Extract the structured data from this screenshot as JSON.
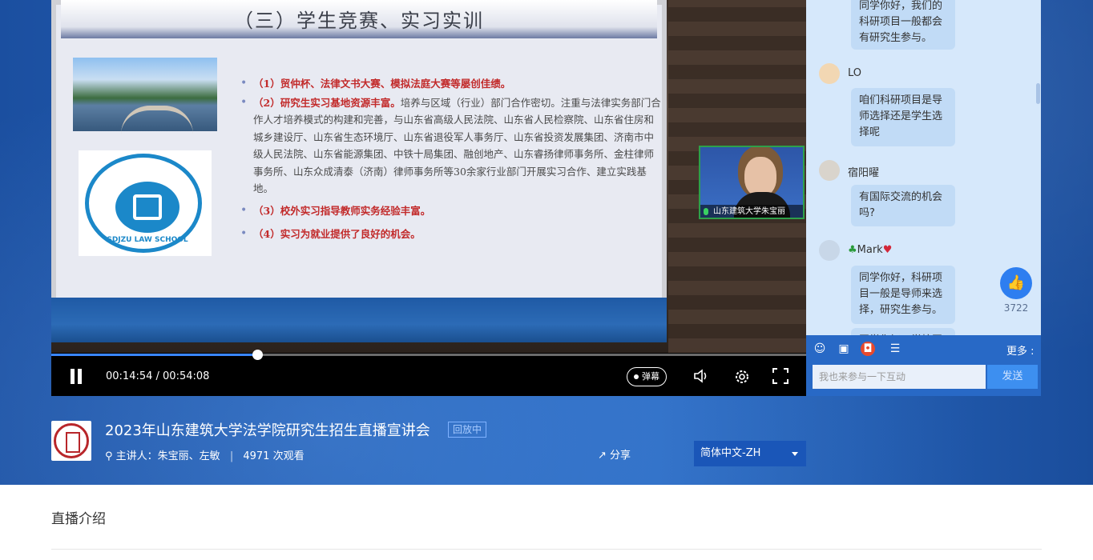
{
  "slide": {
    "title": "（三）学生竞赛、实习实训",
    "logo_text": "SDJZU LAW SCHOOL",
    "bullets": [
      {
        "red": "（1）贸仲杯、法律文书大赛、模拟法庭大赛等屡创佳绩。",
        "rest": ""
      },
      {
        "red": "（2）研究生实习基地资源丰富。",
        "rest": "培养与区域（行业）部门合作密切。注重与法律实务部门合作人才培养模式的构建和完善，与山东省高级人民法院、山东省人民检察院、山东省住房和城乡建设厅、山东省生态环境厅、山东省退役军人事务厅、山东省投资发展集团、济南市中级人民法院、山东省能源集团、中铁十局集团、融创地产、山东睿扬律师事务所、金柱律师事务所、山东众成清泰（济南）律师事务所等30余家行业部门开展实习合作、建立实践基地。"
      },
      {
        "red": "（3）校外实习指导教师实务经验丰富。",
        "rest": ""
      },
      {
        "red": "（4）实习为就业提供了良好的机会。",
        "rest": ""
      }
    ]
  },
  "webcam": {
    "label": "山东建筑大学朱宝丽"
  },
  "player": {
    "time": "00:14:54 / 00:54:08",
    "progress": 0.275,
    "danmu_label": "弹幕"
  },
  "chat": {
    "messages": [
      {
        "name": "",
        "text": "同学你好，我们的科研项目一般都会有研究生参与。"
      },
      {
        "name": "LO",
        "text": "咱们科研项目是导师选择还是学生选择呢"
      },
      {
        "name": "宿阳曜",
        "text": "有国际交流的机会吗?"
      },
      {
        "name": "Mark",
        "text": "同学你好，科研项目一般是导师来选择，研究生参与。"
      },
      {
        "name": "",
        "text": "同学你好，学校同"
      }
    ],
    "like_count": "3722",
    "more_label": "更多",
    "input_placeholder": "我也来参与一下互动",
    "send_label": "发送"
  },
  "info": {
    "title": "2023年山东建筑大学法学院研究生招生直播宣讲会",
    "status": "回放中",
    "host": "主讲人：朱宝丽、左敏",
    "views": "4971 次观看",
    "share_label": "分享",
    "language": "简体中文-ZH"
  },
  "section": {
    "title": "直播介绍"
  },
  "colors": {
    "accent": "#2e7ef0",
    "hero": "#2766bd",
    "progress": "#3a86ff"
  }
}
